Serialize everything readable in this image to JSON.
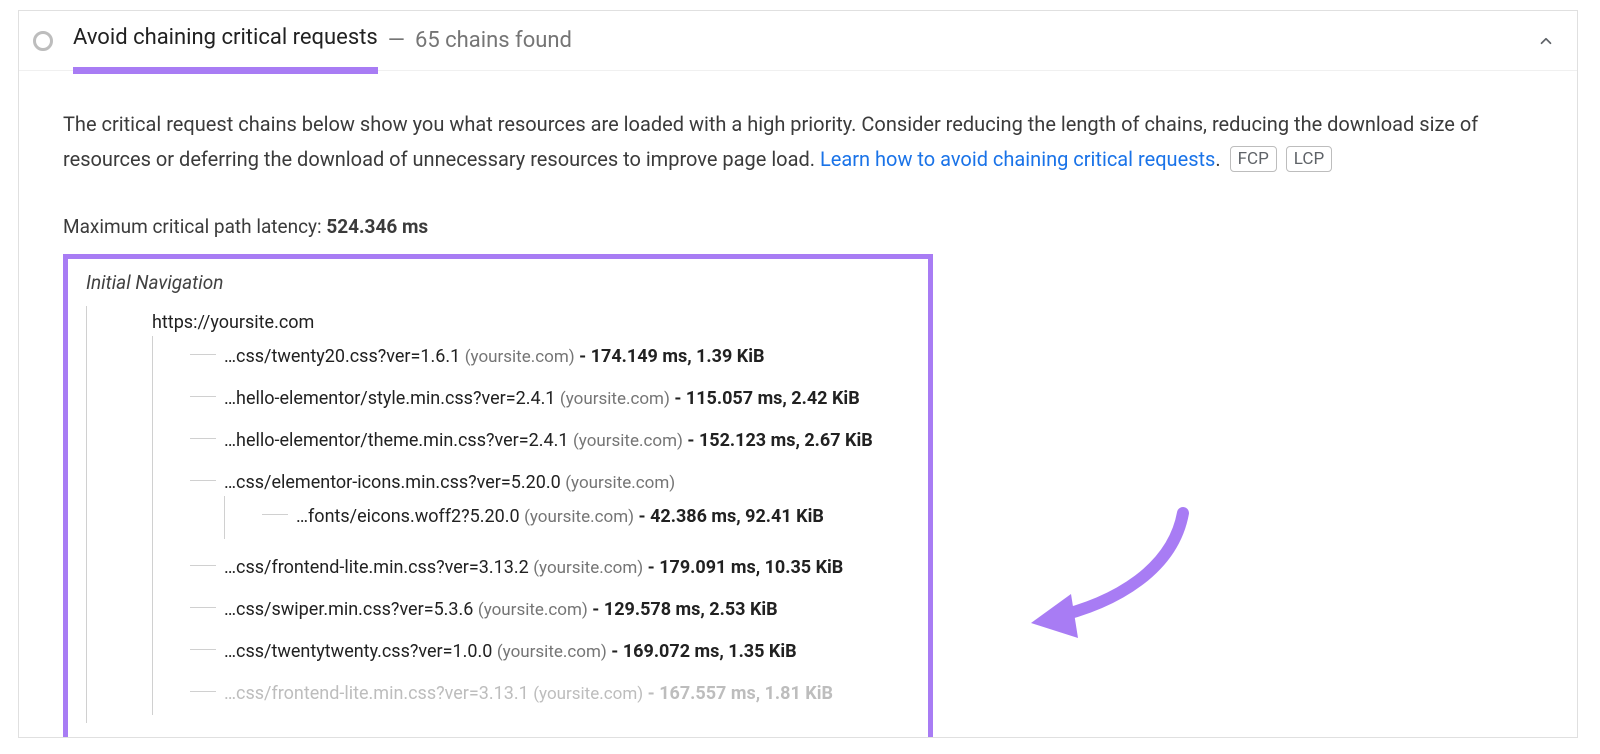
{
  "audit": {
    "title": "Avoid chaining critical requests",
    "separator": "—",
    "count_label": "65 chains found",
    "description_pre": "The critical request chains below show you what resources are loaded with a high priority. Consider reducing the length of chains, reducing the download size of resources or deferring the download of unnecessary resources to improve page load. ",
    "learn_link": "Learn how to avoid chaining critical requests",
    "description_post": ".",
    "tags": [
      "FCP",
      "LCP"
    ],
    "latency_label": "Maximum critical path latency: ",
    "latency_value": "524.346 ms"
  },
  "tree": {
    "root_label": "Initial Navigation",
    "url": "https://yoursite.com",
    "origin": "(yoursite.com)",
    "children": [
      {
        "path": "…css/twenty20.css?ver=1.6.1",
        "metrics": "174.149 ms, 1.39 KiB"
      },
      {
        "path": "…hello-elementor/style.min.css?ver=2.4.1",
        "metrics": "115.057 ms, 2.42 KiB"
      },
      {
        "path": "…hello-elementor/theme.min.css?ver=2.4.1",
        "metrics": "152.123 ms, 2.67 KiB"
      },
      {
        "path": "…css/elementor-icons.min.css?ver=5.20.0",
        "metrics": "",
        "children": [
          {
            "path": "…fonts/eicons.woff2?5.20.0",
            "metrics": "42.386 ms, 92.41 KiB"
          }
        ]
      },
      {
        "path": "…css/frontend-lite.min.css?ver=3.13.2",
        "metrics": "179.091 ms, 10.35 KiB"
      },
      {
        "path": "…css/swiper.min.css?ver=5.3.6",
        "metrics": "129.578 ms, 2.53 KiB"
      },
      {
        "path": "…css/twentytwenty.css?ver=1.0.0",
        "metrics": "169.072 ms, 1.35 KiB"
      },
      {
        "path": "…css/frontend-lite.min.css?ver=3.13.1",
        "metrics": "167.557 ms, 1.81 KiB",
        "overflow": true
      }
    ]
  }
}
